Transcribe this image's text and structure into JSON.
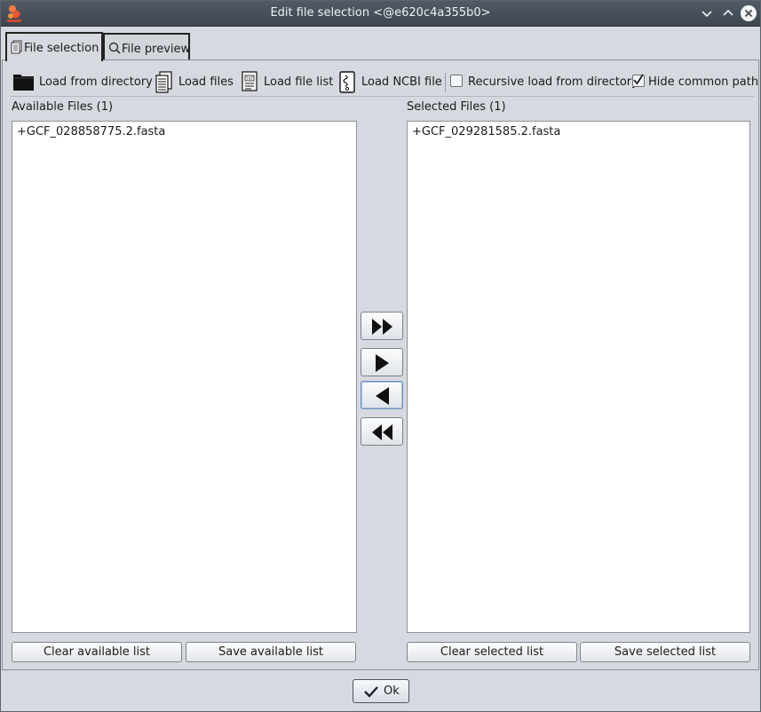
{
  "window": {
    "title": "Edit file selection <@e620c4a355b0>"
  },
  "tabs": [
    {
      "label": "File selection",
      "active": true
    },
    {
      "label": "File preview",
      "active": false
    }
  ],
  "toolbar": {
    "load_directory": "Load from directory",
    "load_files": "Load files",
    "load_file_list": "Load file list",
    "load_ncbi": "Load NCBI file",
    "recursive_label": "Recursive load from directory",
    "recursive_checked": false,
    "hide_path_label": "Hide common path",
    "hide_path_checked": true
  },
  "available": {
    "label": "Available Files (1)",
    "items": [
      "+GCF_028858775.2.fasta"
    ],
    "clear_label": "Clear available list",
    "save_label": "Save available list"
  },
  "selected": {
    "label": "Selected Files (1)",
    "items": [
      "+GCF_029281585.2.fasta"
    ],
    "clear_label": "Clear selected list",
    "save_label": "Save selected list"
  },
  "footer": {
    "ok_label": "Ok"
  },
  "colors": {
    "titlebar": "#3e4650",
    "background": "#d6d9df",
    "accent": "#e8563a"
  }
}
